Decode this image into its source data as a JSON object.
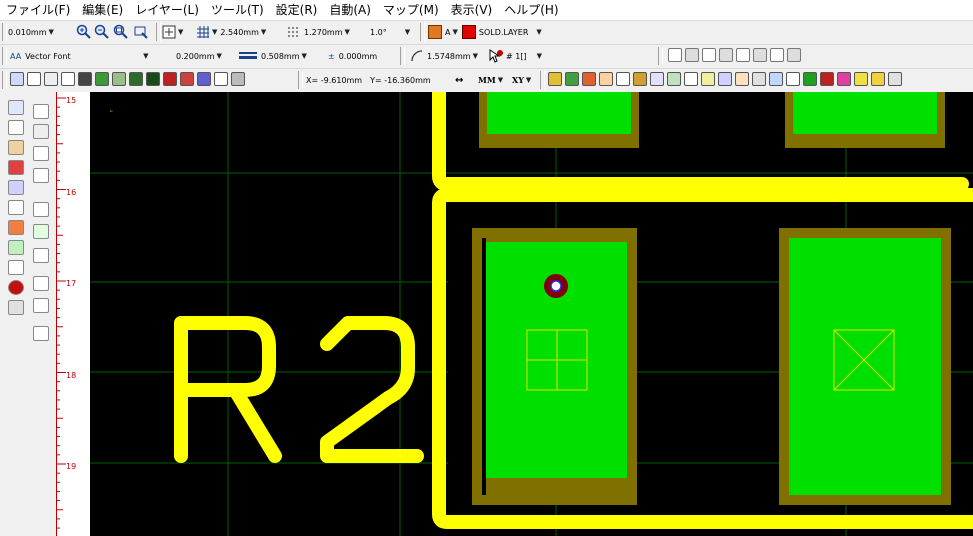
{
  "menu": [
    "ファイル(F)",
    "編集(E)",
    "レイヤー(L)",
    "ツール(T)",
    "設定(R)",
    "自動(A)",
    "マップ(M)",
    "表示(V)",
    "ヘルプ(H)"
  ],
  "toolbar1": {
    "snap_value": "0.010mm",
    "grid_value": "2.540mm",
    "grid2_value": "1.270mm",
    "angle_value": "1.0°",
    "layer_letter": "A",
    "layer_name": "SOLD.LAYER"
  },
  "toolbar2": {
    "font_prefix": "AA",
    "font_name": "Vector Font",
    "text_size": "0.200mm",
    "line_width": "0.508mm",
    "offset_value": "0.000mm",
    "arc_value": "1.5748mm",
    "pad_value": "# 1[]"
  },
  "toolbar3": {
    "x_coord": "X= -9.610mm",
    "y_coord": "Y= -16.360mm",
    "unit_button": "MM",
    "xy_button": "XY"
  },
  "ruler": {
    "labels": [
      "15",
      "16",
      "17",
      "18",
      "19"
    ]
  },
  "canvas": {
    "silk_text": "R2",
    "colors": {
      "background": "#000000",
      "silk": "#ffff00",
      "pad_fill": "#00e000",
      "pad_border": "#807000",
      "via_ring": "#800000",
      "grid": "#006000"
    }
  },
  "icons": {
    "zoom_in": "zoom-in-icon",
    "zoom_out": "zoom-out-icon",
    "zoom_window": "zoom-window-icon",
    "grid": "grid-icon",
    "layer": "layer-color-icon"
  }
}
